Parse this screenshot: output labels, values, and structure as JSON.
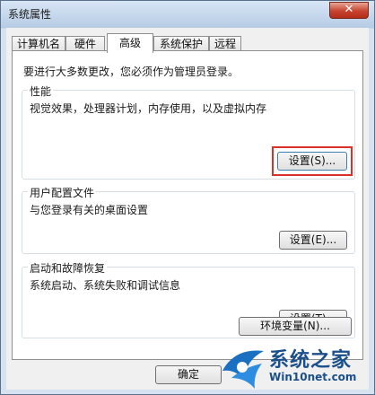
{
  "window": {
    "title": "系统属性",
    "close_glyph": "✕"
  },
  "tabs": [
    {
      "label": "计算机名"
    },
    {
      "label": "硬件"
    },
    {
      "label": "高级"
    },
    {
      "label": "系统保护"
    },
    {
      "label": "远程"
    }
  ],
  "notice": "要进行大多数更改，您必须作为管理员登录。",
  "performance": {
    "label": "性能",
    "desc": "视觉效果，处理器计划，内存使用，以及虚拟内存",
    "button": "设置(S)..."
  },
  "user_profiles": {
    "label": "用户配置文件",
    "desc": "与您登录有关的桌面设置",
    "button": "设置(E)..."
  },
  "startup_recovery": {
    "label": "启动和故障恢复",
    "desc": "系统启动、系统失败和调试信息",
    "button": "设置(T)..."
  },
  "env_button": "环境变量(N)...",
  "footer": {
    "ok_button": "确定"
  },
  "watermark": {
    "brand": "系统之家",
    "url": "Win10net.com"
  },
  "colors": {
    "highlight": "#d9302a",
    "accent": "#3c7fb1"
  }
}
